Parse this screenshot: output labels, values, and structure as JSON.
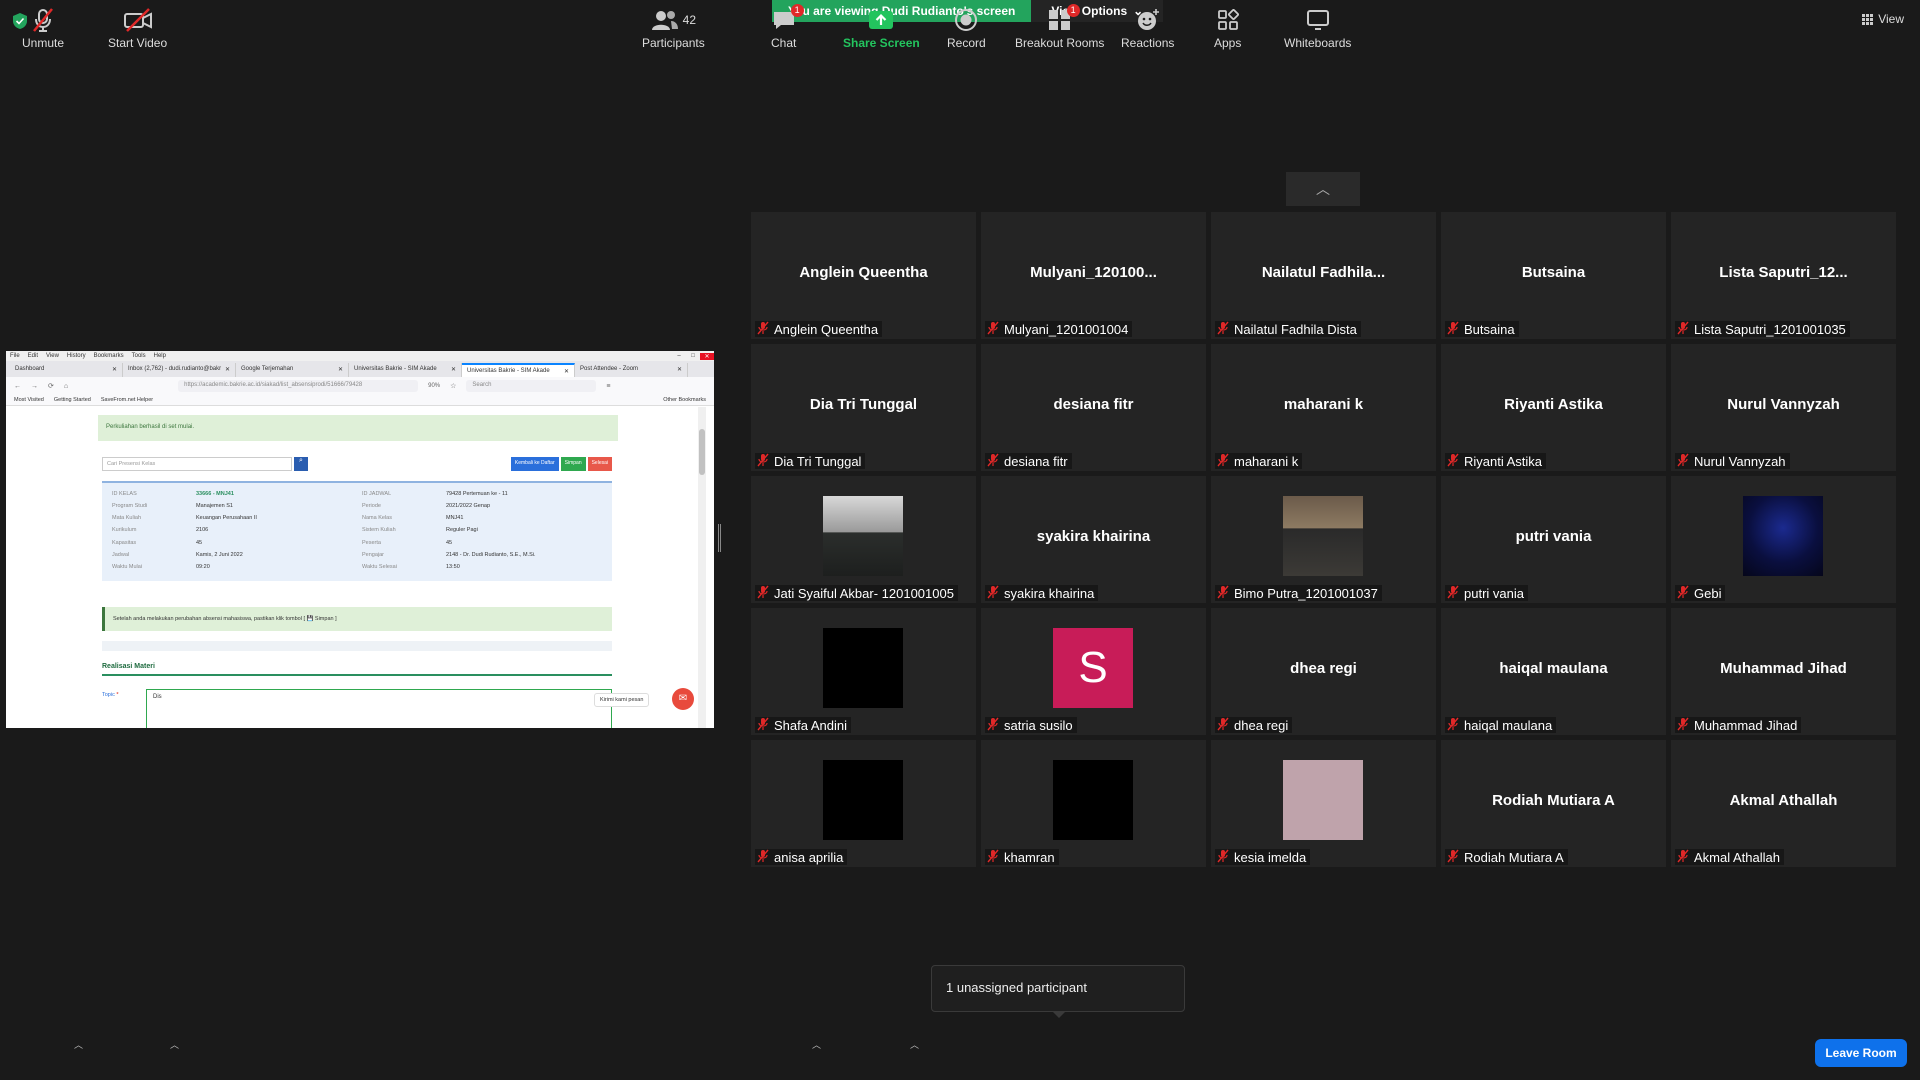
{
  "banner": {
    "viewing": "You are viewing Dudi Rudianto's screen",
    "view_options": "View Options"
  },
  "view_label": "View",
  "shared_screen": {
    "menu": [
      "File",
      "Edit",
      "View",
      "History",
      "Bookmarks",
      "Tools",
      "Help"
    ],
    "tabs": [
      "Dashboard",
      "Inbox (2,762) - dudi.rudianto@bakr",
      "Google Terjemahan",
      "Universitas Bakrie - SIM Akade",
      "Universitas Bakrie - SIM Akade",
      "Post Attendee - Zoom"
    ],
    "url": "https://academic.bakrie.ac.id/siakad/list_absensiprodi/51666/79428",
    "zoom": "90%",
    "search": "Search",
    "bookmarks": [
      "Most Visited",
      "Getting Started",
      "SaveFrom.net Helper"
    ],
    "other_bookmarks": "Other Bookmarks",
    "alert_started": "Perkuliahan berhasil di set mulai.",
    "search_placeholder": "Cari Presensi Kelas",
    "btn_back": "Kembali ke Daftar",
    "btn_save": "Simpan",
    "btn_done": "Selesai",
    "info": {
      "id_kelas_lbl": "ID KELAS",
      "id_kelas": "33666 - MNJ41",
      "id_jadwal_lbl": "ID JADWAL",
      "id_jadwal": "79428 Pertemuan ke - 11",
      "prodi_lbl": "Program Studi",
      "prodi": "Manajemen S1",
      "periode_lbl": "Periode",
      "periode": "2021/2022 Genap",
      "mk_lbl": "Mata Kuliah",
      "mk": "Keuangan Perusahaan II",
      "nama_kelas_lbl": "Nama Kelas",
      "nama_kelas": "MNJ41",
      "kurikulum_lbl": "Kurikulum",
      "kurikulum": "2106",
      "sistem_lbl": "Sistem Kuliah",
      "sistem": "Reguler Pagi",
      "kapasitas_lbl": "Kapasitas",
      "kapasitas": "45",
      "peserta_lbl": "Peserta",
      "peserta": "45",
      "jadwal_lbl": "Jadwal",
      "jadwal": "Kamis, 2 Juni 2022",
      "pengajar_lbl": "Pengajar",
      "pengajar": "2148 - Dr. Dudi Rudianto, S.E., M.Si.",
      "mulai_lbl": "Waktu Mulai",
      "mulai": "09:20",
      "selesai_lbl": "Waktu Selesai",
      "selesai": "13:50"
    },
    "alert_save": "Setelah anda melakukan perubahan absensi mahasiswa, pastikan klik tombol [ 💾 Simpan ]",
    "realisasi": "Realisasi Materi",
    "topic_label": "Topic",
    "topic_value": "Dis",
    "chat_tip": "Kirimi kami pesan"
  },
  "participants": [
    {
      "big": "Anglein Queentha",
      "label": "Anglein Queentha"
    },
    {
      "big": "Mulyani_120100...",
      "label": "Mulyani_1201001004"
    },
    {
      "big": "Nailatul Fadhila...",
      "label": "Nailatul Fadhila Dista"
    },
    {
      "big": "Butsaina",
      "label": "Butsaina"
    },
    {
      "big": "Lista Saputri_12...",
      "label": "Lista Saputri_1201001035"
    },
    {
      "big": "Dia Tri Tunggal",
      "label": "Dia Tri Tunggal"
    },
    {
      "big": "desiana fitr",
      "label": "desiana fitr"
    },
    {
      "big": "maharani k",
      "label": "maharani k"
    },
    {
      "big": "Riyanti Astika",
      "label": "Riyanti Astika"
    },
    {
      "big": "Nurul Vannyzah",
      "label": "Nurul Vannyzah"
    },
    {
      "big": "",
      "label": "Jati Syaiful Akbar- 1201001005",
      "video": "photo-person"
    },
    {
      "big": "syakira khairina",
      "label": "syakira khairina"
    },
    {
      "big": "",
      "label": "Bimo Putra_1201001037",
      "video": "photo-person-outdoor"
    },
    {
      "big": "putri vania",
      "label": "putri vania"
    },
    {
      "big": "",
      "label": "Gebi",
      "video": "photo-dark-blue"
    },
    {
      "big": "",
      "label": "Shafa Andini",
      "video": "black"
    },
    {
      "big": "",
      "label": "satria susilo",
      "video": "letter",
      "letter": "S"
    },
    {
      "big": "dhea regi",
      "label": "dhea regi"
    },
    {
      "big": "haiqal maulana",
      "label": "haiqal maulana"
    },
    {
      "big": "Muhammad Jihad",
      "label": "Muhammad Jihad"
    },
    {
      "big": "",
      "label": "anisa aprilia",
      "video": "black"
    },
    {
      "big": "",
      "label": "khamran",
      "video": "black"
    },
    {
      "big": "",
      "label": "kesia imelda",
      "video": "pink"
    },
    {
      "big": "Rodiah Mutiara A",
      "label": "Rodiah Mutiara A"
    },
    {
      "big": "Akmal Athallah",
      "label": "Akmal Athallah"
    }
  ],
  "toast": "1 unassigned participant",
  "toolbar": {
    "unmute": "Unmute",
    "start_video": "Start Video",
    "participants": "Participants",
    "participants_count": "42",
    "chat": "Chat",
    "chat_badge": "1",
    "share_screen": "Share Screen",
    "record": "Record",
    "breakout": "Breakout Rooms",
    "breakout_badge": "1",
    "reactions": "Reactions",
    "apps": "Apps",
    "whiteboards": "Whiteboards",
    "leave": "Leave Room"
  },
  "colors": {
    "accent_green": "#23a45d",
    "leave_blue": "#0e71eb",
    "badge_red": "#e02828",
    "avatar_s": "#c81c58"
  }
}
